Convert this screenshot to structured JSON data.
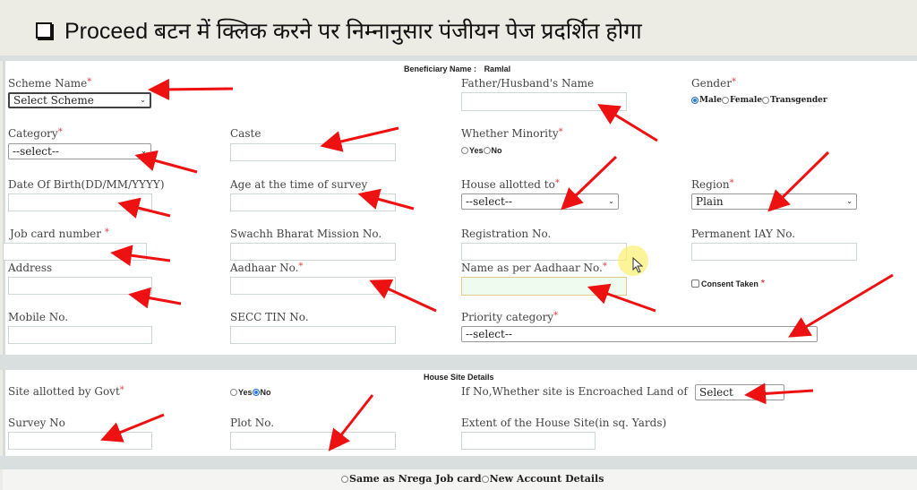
{
  "slide": {
    "title": "Proceed बटन में क्लिक करने पर निम्नानुसार पंजीयन पेज प्रदर्शित होगा"
  },
  "beneficiary": {
    "label": "Beneficiary Name :",
    "value": "Ramlal"
  },
  "form": {
    "scheme_name": {
      "label": "Scheme Name",
      "required": "*",
      "value": "Select Scheme"
    },
    "father_husband_name": {
      "label": "Father/Husband's Name",
      "value": ""
    },
    "gender": {
      "label": "Gender",
      "required": "*",
      "options": [
        "Male",
        "Female",
        "Transgender"
      ],
      "selected": "Male"
    },
    "category": {
      "label": "Category",
      "required": "*",
      "value": "--select--"
    },
    "caste": {
      "label": "Caste",
      "value": ""
    },
    "whether_minority": {
      "label": "Whether Minority",
      "required": "*",
      "options": [
        "Yes",
        "No"
      ],
      "selected": ""
    },
    "dob": {
      "label": "Date Of Birth(DD/MM/YYYY)",
      "value": ""
    },
    "age_at_survey": {
      "label": "Age at the time of survey",
      "value": ""
    },
    "house_allotted_to": {
      "label": "House allotted to",
      "required": "*",
      "value": "--select--"
    },
    "region": {
      "label": "Region",
      "required": "*",
      "value": "Plain"
    },
    "job_card_number": {
      "label": "Job card number",
      "required": "*",
      "value": ""
    },
    "swachh_bharat_no": {
      "label": "Swachh Bharat Mission No.",
      "value": ""
    },
    "registration_no": {
      "label": "Registration No.",
      "value": ""
    },
    "permanent_iay_no": {
      "label": "Permanent IAY No.",
      "value": ""
    },
    "address": {
      "label": "Address",
      "value": ""
    },
    "aadhaar_no": {
      "label": "Aadhaar No.",
      "required": "*",
      "value": ""
    },
    "name_as_per_aadhaar": {
      "label": "Name as per Aadhaar No.",
      "required": "*",
      "value": ""
    },
    "consent_taken": {
      "label": "Consent Taken",
      "required": "*",
      "checked": false
    },
    "mobile_no": {
      "label": "Mobile No.",
      "value": ""
    },
    "secc_tin_no": {
      "label": "SECC TIN No.",
      "value": ""
    },
    "priority_category": {
      "label": "Priority category",
      "required": "*",
      "value": "--select--"
    }
  },
  "house_site": {
    "heading": "House Site Details",
    "site_allotted_by_govt": {
      "label": "Site allotted by Govt",
      "required": "*",
      "options": [
        "Yes",
        "No"
      ],
      "selected": "No"
    },
    "encroached_land": {
      "label": "If No,Whether site is Encroached Land of",
      "value": "Select"
    },
    "survey_no": {
      "label": "Survey No",
      "value": ""
    },
    "plot_no": {
      "label": "Plot No.",
      "value": ""
    },
    "extent": {
      "label": "Extent of the House Site(in sq. Yards)",
      "value": ""
    }
  },
  "account": {
    "options": [
      "Same as Nrega Job card",
      "New Account Details"
    ],
    "selected": ""
  },
  "colors": {
    "annotation_arrow": "#ee1111",
    "required_star": "#e04040",
    "radio_selected": "#2f7fe0"
  }
}
